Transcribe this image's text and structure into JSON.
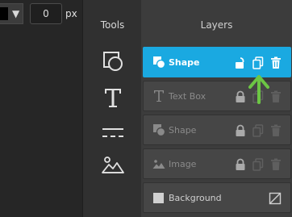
{
  "toolbar": {
    "color_value": "#000000",
    "number_value": "0",
    "unit": "px"
  },
  "tools": {
    "title": "Tools",
    "items": [
      {
        "name": "shape-tool",
        "icon": "shape-icon"
      },
      {
        "name": "text-tool",
        "icon": "text-icon"
      },
      {
        "name": "line-tool",
        "icon": "line-icon"
      },
      {
        "name": "image-tool",
        "icon": "image-icon"
      }
    ]
  },
  "layers": {
    "title": "Layers",
    "items": [
      {
        "label": "Shape",
        "icon": "shape-icon",
        "active": true,
        "locked": false
      },
      {
        "label": "Text Box",
        "icon": "text-icon",
        "active": false,
        "locked": true
      },
      {
        "label": "Shape",
        "icon": "shape-icon",
        "active": false,
        "locked": true
      },
      {
        "label": "Image",
        "icon": "image-icon",
        "active": false,
        "locked": true
      },
      {
        "label": "Background",
        "icon": "square-icon",
        "active": false,
        "locked": false
      }
    ]
  },
  "colors": {
    "accent": "#1aa9e1",
    "indicator": "#6cc644"
  }
}
